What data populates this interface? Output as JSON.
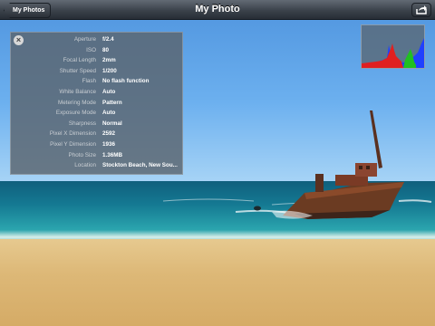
{
  "navbar": {
    "back_label": "My Photos",
    "title": "My Photo"
  },
  "icons": {
    "back": "chevron-back-button",
    "share": "share-icon",
    "close": "close-icon"
  },
  "exif": {
    "rows": [
      {
        "label": "Aperture",
        "value": "f/2.4"
      },
      {
        "label": "ISO",
        "value": "80"
      },
      {
        "label": "Focal Length",
        "value": "2mm"
      },
      {
        "label": "Shutter Speed",
        "value": "1/200"
      },
      {
        "label": "Flash",
        "value": "No flash function"
      },
      {
        "label": "White Balance",
        "value": "Auto"
      },
      {
        "label": "Metering Mode",
        "value": "Pattern"
      },
      {
        "label": "Exposure Mode",
        "value": "Auto"
      },
      {
        "label": "Sharpness",
        "value": "Normal"
      },
      {
        "label": "Pixel X Dimension",
        "value": "2592"
      },
      {
        "label": "Pixel Y Dimension",
        "value": "1936"
      },
      {
        "label": "Photo Size",
        "value": "1.36MB"
      },
      {
        "label": "Location",
        "value": "Stockton Beach, New Sou..."
      }
    ]
  },
  "colors": {
    "navbar": "#3b424b",
    "histogram_red": "#e02020",
    "histogram_green": "#20c020",
    "histogram_blue": "#2040ff"
  }
}
